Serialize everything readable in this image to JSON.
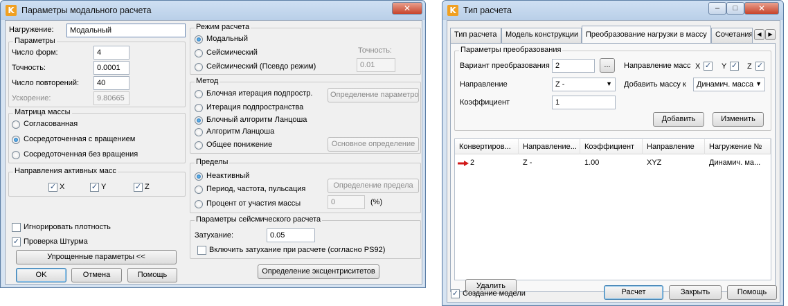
{
  "left_window": {
    "title": "Параметры модального расчета",
    "load_label": "Нагружение:",
    "load_value": "Модальный",
    "params": {
      "title": "Параметры",
      "forms_label": "Число форм:",
      "forms_value": "4",
      "precision_label": "Точность:",
      "precision_value": "0.0001",
      "repeats_label": "Число повторений:",
      "repeats_value": "40",
      "accel_label": "Ускорение:",
      "accel_value": "9.80665"
    },
    "mass_matrix": {
      "title": "Матрица массы",
      "opt1": "Согласованная",
      "opt2": "Сосредоточенная с вращением",
      "opt3": "Сосредоточенная без вращения"
    },
    "active_dirs": {
      "title": "Направления активных масс",
      "x": "X",
      "y": "Y",
      "z": "Z"
    },
    "ignore_density": "Игнорировать плотность",
    "sturm_check": "Проверка Штурма",
    "simplified_btn": "Упрощенные параметры <<",
    "ok": "OK",
    "cancel": "Отмена",
    "help": "Помощь",
    "mode": {
      "title": "Режим расчета",
      "opt1": "Модальный",
      "opt2": "Сейсмический",
      "opt3": "Сейсмический (Псевдо режим)",
      "precision_label": "Точность:",
      "precision_value": "0.01"
    },
    "method": {
      "title": "Метод",
      "opt1": "Блочная итерация подпростр.",
      "opt2": "Итерация подпространства",
      "opt3": "Блочный алгоритм Ланцоша",
      "opt4": "Алгоритм Ланцоша",
      "opt5": "Общее понижение",
      "params_btn": "Определение параметров",
      "base_btn": "Основное определение"
    },
    "limits": {
      "title": "Пределы",
      "opt1": "Неактивный",
      "opt2": "Период, частота, пульсация",
      "opt3": "Процент от участия массы",
      "limit_btn": "Определение предела",
      "percent_value": "0",
      "percent_unit": "(%)"
    },
    "seismic": {
      "title": "Параметры сейсмического расчета",
      "damping_label": "Затухание:",
      "damping_value": "0.05",
      "damping_check": "Включить затухание при расчете (согласно PS92)"
    },
    "eccentricity_btn": "Определение эксцентриситетов"
  },
  "right_window": {
    "title": "Тип расчета",
    "tabs": [
      "Тип расчета",
      "Модель конструкции",
      "Преобразование нагрузки в массу",
      "Сочетания"
    ],
    "group_title": "Параметры преобразования",
    "variant_label": "Вариант преобразования",
    "variant_value": "2",
    "dots_btn": "...",
    "mass_dir_label": "Направление масс",
    "x": "X",
    "y": "Y",
    "z": "Z",
    "direction_label": "Направление",
    "direction_value": "Z -",
    "add_mass_label": "Добавить массу к",
    "add_mass_value": "Динамич. масса",
    "coef_label": "Коэффициент",
    "coef_value": "1",
    "add_btn": "Добавить",
    "edit_btn": "Изменить",
    "table": {
      "headers": [
        "Конвертиров...",
        "Направление...",
        "Коэффициент",
        "Направление",
        "Нагружение №"
      ],
      "row": [
        "2",
        "Z -",
        "1.00",
        "XYZ",
        "Динамич. ма..."
      ]
    },
    "delete_btn": "Удалить",
    "create_model": "Создание модели",
    "calc_btn": "Расчет",
    "close_btn": "Закрыть",
    "help_btn": "Помощь"
  }
}
